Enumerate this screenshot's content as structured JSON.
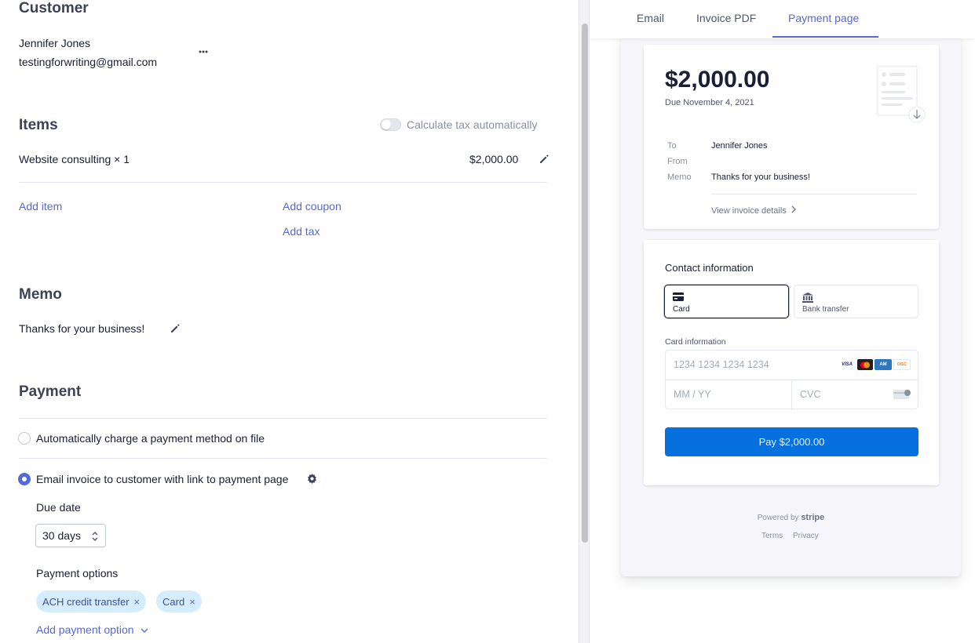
{
  "customer": {
    "heading": "Customer",
    "name": "Jennifer Jones",
    "email": "testingforwriting@gmail.com",
    "more_icon": "more-horizontal-icon"
  },
  "items": {
    "heading": "Items",
    "tax_toggle_label": "Calculate tax automatically",
    "tax_toggle_on": false,
    "line_item": {
      "description": "Website consulting × 1",
      "amount": "$2,000.00"
    },
    "add_item": "Add item",
    "add_coupon": "Add coupon",
    "add_tax": "Add tax"
  },
  "memo": {
    "heading": "Memo",
    "text": "Thanks for your business!"
  },
  "payment": {
    "heading": "Payment",
    "option_auto": "Automatically charge a payment method on file",
    "option_email": "Email invoice to customer with link to payment page",
    "selected": "option_email",
    "due_date_label": "Due date",
    "due_date_value": "30 days",
    "payment_options_label": "Payment options",
    "payment_options": [
      "ACH credit transfer",
      "Card"
    ],
    "add_payment_option": "Add payment option"
  },
  "preview_tabs": {
    "tabs": [
      "Email",
      "Invoice PDF",
      "Payment page"
    ],
    "active": "Payment page"
  },
  "payment_page": {
    "amount": "$2,000.00",
    "due": "Due November 4, 2021",
    "to_label": "To",
    "to_value": "Jennifer Jones",
    "from_label": "From",
    "memo_label": "Memo",
    "memo_value": "Thanks for your business!",
    "view_details": "View invoice details",
    "contact_title": "Contact information",
    "methods": [
      "Card",
      "Bank transfer"
    ],
    "card_info_label": "Card information",
    "card_number_placeholder": "1234 1234 1234 1234",
    "expiry_placeholder": "MM / YY",
    "cvc_placeholder": "CVC",
    "card_brands": [
      "VISA",
      "mastercard",
      "amex",
      "discover"
    ],
    "pay_button": "Pay $2,000.00",
    "powered_by": "Powered by",
    "powered_brand": "stripe",
    "terms": "Terms",
    "privacy": "Privacy"
  },
  "colors": {
    "accent": "#5469d4",
    "pay_button": "#0570de",
    "chip_bg": "#d6ecff"
  }
}
